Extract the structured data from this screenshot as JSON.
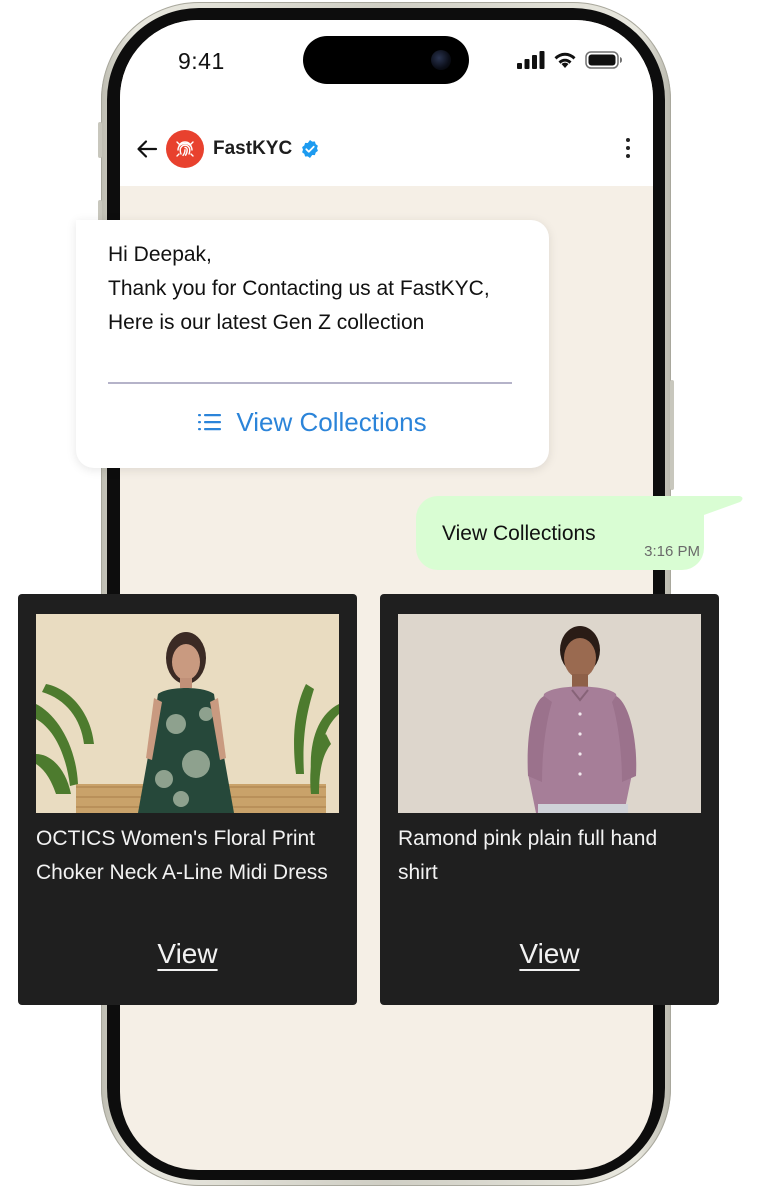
{
  "status_bar": {
    "time": "9:41"
  },
  "chat_header": {
    "contact_name": "FastKYC"
  },
  "incoming_message": {
    "text": "Hi Deepak,\nThank you for Contacting us at FastKYC,  Here is our latest Gen Z collection",
    "action_label": "View Collections"
  },
  "outgoing_message": {
    "text": "View Collections",
    "time": "3:16 PM"
  },
  "products": [
    {
      "title": "OCTICS Women's Floral Print Choker Neck A-Line Midi Dress",
      "view_label": "View"
    },
    {
      "title": "Ramond pink plain full hand shirt",
      "view_label": "View"
    }
  ],
  "colors": {
    "brand_red": "#e8412e",
    "link_blue": "#2b84d9",
    "verified_blue": "#1d9bf0",
    "outgoing_bubble": "#d9fdd3",
    "chat_background": "#f5efe6",
    "card_background": "#1f1f1f"
  },
  "icons": [
    "back-arrow-icon",
    "fingerprint-icon",
    "verified-badge-icon",
    "more-vert-icon",
    "signal-icon",
    "wifi-icon",
    "battery-icon",
    "list-icon"
  ]
}
